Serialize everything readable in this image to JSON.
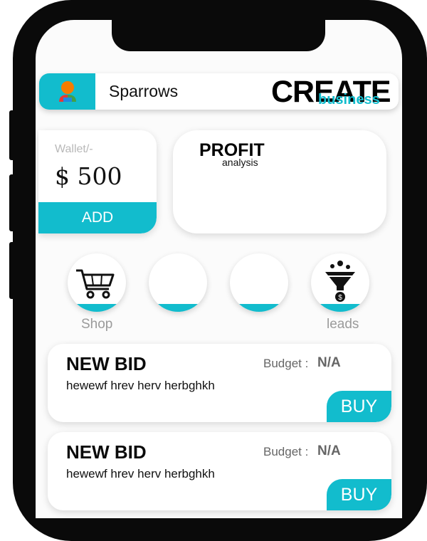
{
  "header": {
    "user_name": "Sparrows",
    "brand_title": "CREATE",
    "brand_subtitle": "business"
  },
  "wallet": {
    "label": "Wallet/-",
    "amount": "$ 500",
    "add_label": "ADD"
  },
  "profit": {
    "title": "PROFIT",
    "subtitle": "analysis"
  },
  "shortcuts": [
    {
      "label": "Shop",
      "icon": "shopping-cart-icon"
    },
    {
      "label": "",
      "icon": ""
    },
    {
      "label": "",
      "icon": ""
    },
    {
      "label": "leads",
      "icon": "funnel-icon"
    }
  ],
  "bids": [
    {
      "title": "NEW BID",
      "description": "hewewf hrev herv herbghkh",
      "budget_label": "Budget :",
      "budget_value": "N/A",
      "buy_label": "BUY"
    },
    {
      "title": "NEW BID",
      "description": "hewewf hrev herv herbghkh",
      "budget_label": "Budget :",
      "budget_value": "N/A",
      "buy_label": "BUY"
    }
  ],
  "colors": {
    "accent": "#12bccd",
    "frame": "#0a0a0a"
  }
}
